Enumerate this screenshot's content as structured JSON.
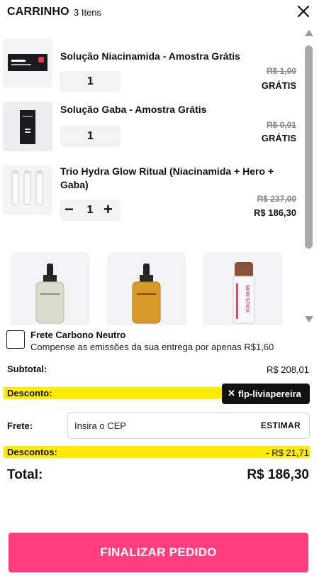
{
  "header": {
    "title": "CARRINHO",
    "item_count": "3 Itens"
  },
  "items": [
    {
      "name": "Solução Niacinamida - Amostra Grátis",
      "qty": "1",
      "old_price": "R$ 1,00",
      "price": "GRÁTIS",
      "thumb_text": "Niacinamida"
    },
    {
      "name": "Solução Gaba - Amostra Grátis",
      "qty": "1",
      "old_price": "R$ 0,01",
      "price": "GRÁTIS",
      "thumb_text": "GABA"
    },
    {
      "name": "Trio Hydra Glow Ritual (Niacinamida + Hero + Gaba)",
      "qty": "1",
      "minus": "−",
      "plus": "+",
      "old_price": "R$ 237,00",
      "price": "R$ 186,30"
    }
  ],
  "recommendations": [
    {
      "kind": "serum-clear"
    },
    {
      "kind": "serum-amber"
    },
    {
      "kind": "skin-stick",
      "label": "SKIN STICK"
    }
  ],
  "carbon": {
    "title": "Frete Carbono Neutro",
    "description": "Compense as emissões da sua entrega por apenas R$1,60"
  },
  "summary": {
    "subtotal_label": "Subtotal:",
    "subtotal_value": "R$ 208,01",
    "discount_label": "Desconto:",
    "coupon_code": "flp-liviapereira",
    "coupon_remove": "✕",
    "shipping_label": "Frete:",
    "cep_placeholder": "Insira o CEP",
    "estimate_label": "ESTIMAR",
    "discounts_label": "Descontos:",
    "discounts_value": "- R$ 21,71",
    "total_label": "Total:",
    "total_value": "R$ 186,30"
  },
  "checkout": {
    "label": "FINALIZAR PEDIDO"
  },
  "colors": {
    "accent": "#ff3d7f",
    "highlight": "#ffeb00"
  }
}
